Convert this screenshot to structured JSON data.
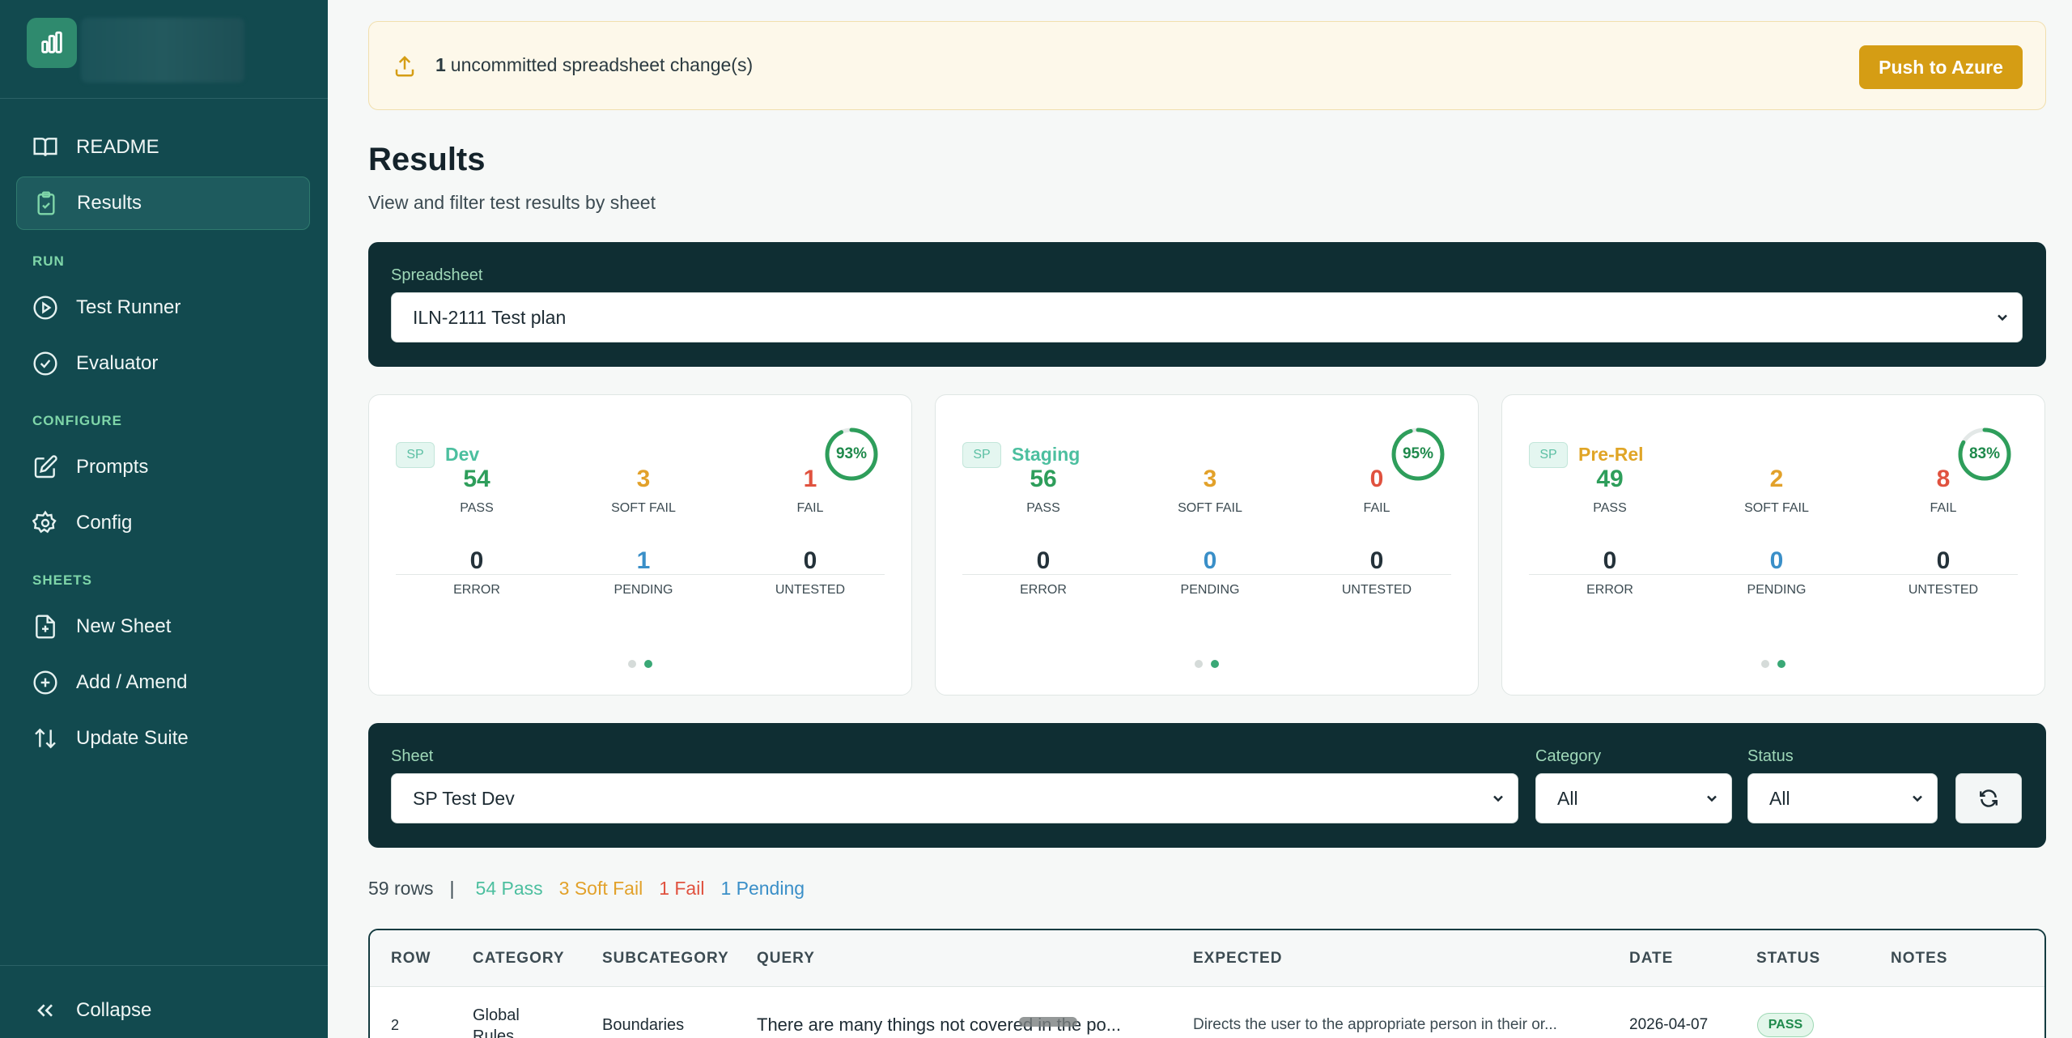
{
  "sidebar": {
    "items": {
      "readme": "README",
      "results": "Results",
      "test_runner": "Test Runner",
      "evaluator": "Evaluator",
      "prompts": "Prompts",
      "config": "Config",
      "new_sheet": "New Sheet",
      "add_amend": "Add / Amend",
      "update_suite": "Update Suite"
    },
    "sections": {
      "run": "RUN",
      "configure": "CONFIGURE",
      "sheets": "SHEETS"
    },
    "collapse": "Collapse"
  },
  "banner": {
    "count": "1",
    "text": "uncommitted spreadsheet change(s)",
    "button": "Push to Azure"
  },
  "page": {
    "title": "Results",
    "subtitle": "View and filter test results by sheet"
  },
  "spreadsheet": {
    "label": "Spreadsheet",
    "value": "ILN-2111 Test plan"
  },
  "cards": [
    {
      "badge": "SP",
      "name": "Dev",
      "color": "#4cbf9f",
      "percent": "93%",
      "fraction": 0.93,
      "stats": {
        "pass": "54",
        "soft_fail": "3",
        "fail": "1",
        "error": "0",
        "pending": "1",
        "untested": "0"
      }
    },
    {
      "badge": "SP",
      "name": "Staging",
      "color": "#4cbf9f",
      "percent": "95%",
      "fraction": 0.95,
      "stats": {
        "pass": "56",
        "soft_fail": "3",
        "fail": "0",
        "error": "0",
        "pending": "0",
        "untested": "0"
      }
    },
    {
      "badge": "SP",
      "name": "Pre-Rel",
      "color": "#e0a526",
      "percent": "83%",
      "fraction": 0.83,
      "stats": {
        "pass": "49",
        "soft_fail": "2",
        "fail": "8",
        "error": "0",
        "pending": "0",
        "untested": "0"
      }
    }
  ],
  "stat_labels": {
    "pass": "PASS",
    "soft_fail": "SOFT FAIL",
    "fail": "FAIL",
    "error": "ERROR",
    "pending": "PENDING",
    "untested": "UNTESTED"
  },
  "filters": {
    "sheet_label": "Sheet",
    "sheet_value": "SP Test Dev",
    "category_label": "Category",
    "category_value": "All",
    "status_label": "Status",
    "status_value": "All"
  },
  "summary": {
    "rows": "59 rows",
    "sep": "|",
    "pass": "54 Pass",
    "soft_fail": "3 Soft Fail",
    "fail": "1 Fail",
    "pending": "1 Pending"
  },
  "table": {
    "headers": [
      "ROW",
      "CATEGORY",
      "SUBCATEGORY",
      "QUERY",
      "EXPECTED",
      "DATE",
      "STATUS",
      "NOTES"
    ],
    "rows": [
      {
        "row": "2",
        "category": "Global Rules",
        "subcategory": "Boundaries",
        "query": "There are many things not covered in the po...",
        "expected": "Directs the user to the appropriate person in their or...",
        "date": "2026-04-07",
        "status": "PASS",
        "notes": ""
      }
    ]
  },
  "colors": {
    "pass": "#2e9e5b",
    "soft_fail": "#e2a12a",
    "fail": "#e0523f",
    "pending": "#3a8fc8",
    "neutral": "#24323a"
  }
}
